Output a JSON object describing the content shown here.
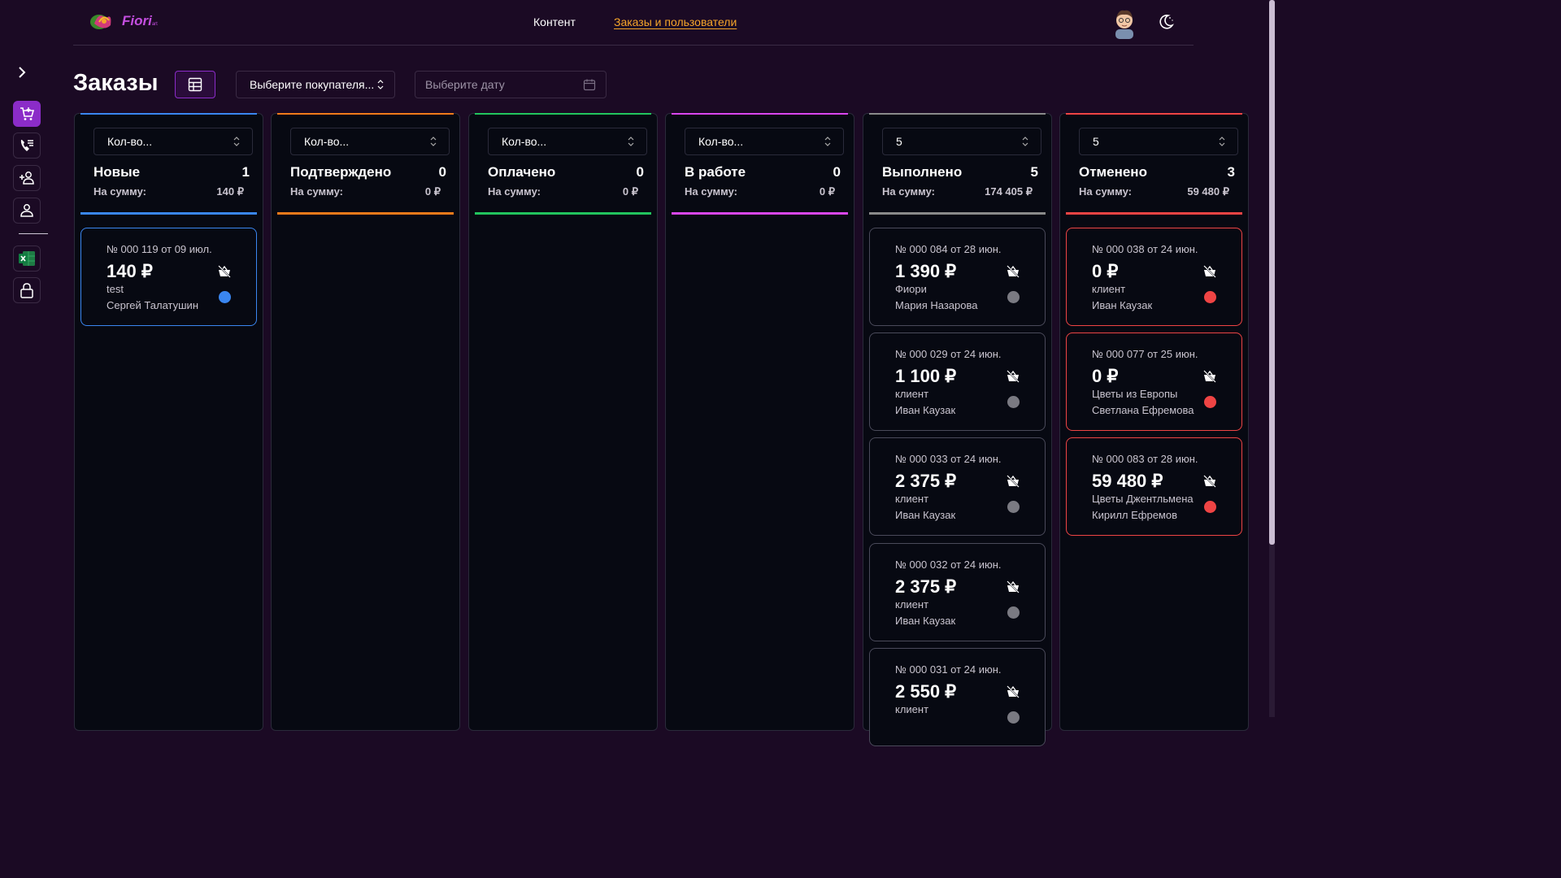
{
  "header": {
    "logo_text": "Fiori",
    "logo_sub": "art",
    "nav": [
      {
        "label": "Контент"
      },
      {
        "label": "Заказы и пользователи"
      }
    ],
    "avatar_icon": "user-avatar",
    "theme_icon": "moon-icon"
  },
  "sidebar": {
    "items": [
      {
        "icon": "cart-icon",
        "active": true
      },
      {
        "icon": "phone-list-icon"
      },
      {
        "icon": "add-user-icon"
      },
      {
        "icon": "user-icon"
      },
      {
        "icon": "excel-icon"
      },
      {
        "icon": "lock-icon"
      }
    ]
  },
  "page": {
    "title": "Заказы",
    "buyer_select": "Выберите покупателя...",
    "date_placeholder": "Выберите дату"
  },
  "colors": {
    "new": "#3a86f0",
    "confirmed": "#f07a1a",
    "paid": "#22c55e",
    "in_work": "#d946ef",
    "done": "#8a8a8a",
    "cancelled": "#ef4444"
  },
  "columns": [
    {
      "select": "Кол-во...",
      "title": "Новые",
      "count": "1",
      "sum_label": "На сумму:",
      "sum": "140 ₽",
      "cards": [
        {
          "num": "№ 000 119 от 09 июл.",
          "price": "140 ₽",
          "client": "test",
          "user": "Сергей Талатушин"
        }
      ]
    },
    {
      "select": "Кол-во...",
      "title": "Подтверждено",
      "count": "0",
      "sum_label": "На сумму:",
      "sum": "0 ₽",
      "cards": []
    },
    {
      "select": "Кол-во...",
      "title": "Оплачено",
      "count": "0",
      "sum_label": "На сумму:",
      "sum": "0 ₽",
      "cards": []
    },
    {
      "select": "Кол-во...",
      "title": "В работе",
      "count": "0",
      "sum_label": "На сумму:",
      "sum": "0 ₽",
      "cards": []
    },
    {
      "select": "5",
      "title": "Выполнено",
      "count": "5",
      "sum_label": "На сумму:",
      "sum": "174 405 ₽",
      "cards": [
        {
          "num": "№ 000 084 от 28 июн.",
          "price": "1 390 ₽",
          "client": "Фиори",
          "user": "Мария Назарова"
        },
        {
          "num": "№ 000 029 от 24 июн.",
          "price": "1 100 ₽",
          "client": "клиент",
          "user": "Иван Каузак"
        },
        {
          "num": "№ 000 033 от 24 июн.",
          "price": "2 375 ₽",
          "client": "клиент",
          "user": "Иван Каузак"
        },
        {
          "num": "№ 000 032 от 24 июн.",
          "price": "2 375 ₽",
          "client": "клиент",
          "user": "Иван Каузак"
        },
        {
          "num": "№ 000 031 от 24 июн.",
          "price": "2 550 ₽",
          "client": "клиент",
          "user": ""
        }
      ]
    },
    {
      "select": "5",
      "title": "Отменено",
      "count": "3",
      "sum_label": "На сумму:",
      "sum": "59 480 ₽",
      "cards": [
        {
          "num": "№ 000 038 от 24 июн.",
          "price": "0 ₽",
          "client": "клиент",
          "user": "Иван Каузак"
        },
        {
          "num": "№ 000 077 от 25 июн.",
          "price": "0 ₽",
          "client": "Цветы из Европы",
          "user": "Светлана Ефремова"
        },
        {
          "num": "№ 000 083 от 28 июн.",
          "price": "59 480 ₽",
          "client": "Цветы Джентльмена",
          "user": "Кирилл Ефремов"
        }
      ]
    }
  ]
}
